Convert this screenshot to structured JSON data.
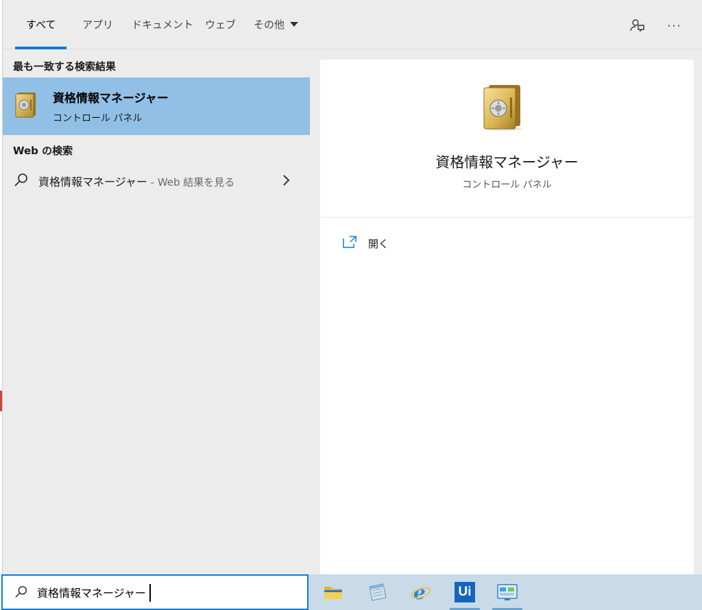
{
  "tabs": [
    {
      "label": "すべて",
      "active": true
    },
    {
      "label": "アプリ"
    },
    {
      "label": "ドキュメント"
    },
    {
      "label": "ウェブ"
    },
    {
      "label": "その他"
    }
  ],
  "top_actions": {
    "feedback_icon": "feedback-icon",
    "more_label": "···"
  },
  "results": {
    "best_match_header": "最も一致する検索結果",
    "best_match": {
      "title": "資格情報マネージャー",
      "subtitle": "コントロール パネル",
      "icon": "credential-manager-safe-icon"
    },
    "web_header": "Web の検索",
    "web_item": {
      "query": "資格情報マネージャー",
      "suffix": " - Web 結果を見る"
    }
  },
  "preview": {
    "title": "資格情報マネージャー",
    "subtitle": "コントロール パネル",
    "actions": [
      {
        "label": "開く",
        "icon": "open-icon"
      }
    ]
  },
  "search": {
    "value": "資格情報マネージャー"
  },
  "taskbar": [
    {
      "name": "file-explorer-icon"
    },
    {
      "name": "notepad-icon"
    },
    {
      "name": "internet-explorer-icon"
    },
    {
      "name": "uipath-icon",
      "label": "Ui"
    },
    {
      "name": "control-panel-icon"
    }
  ],
  "colors": {
    "accent": "#0f78d4",
    "selection": "#91bfe6",
    "taskbar": "#c9dbe9"
  }
}
